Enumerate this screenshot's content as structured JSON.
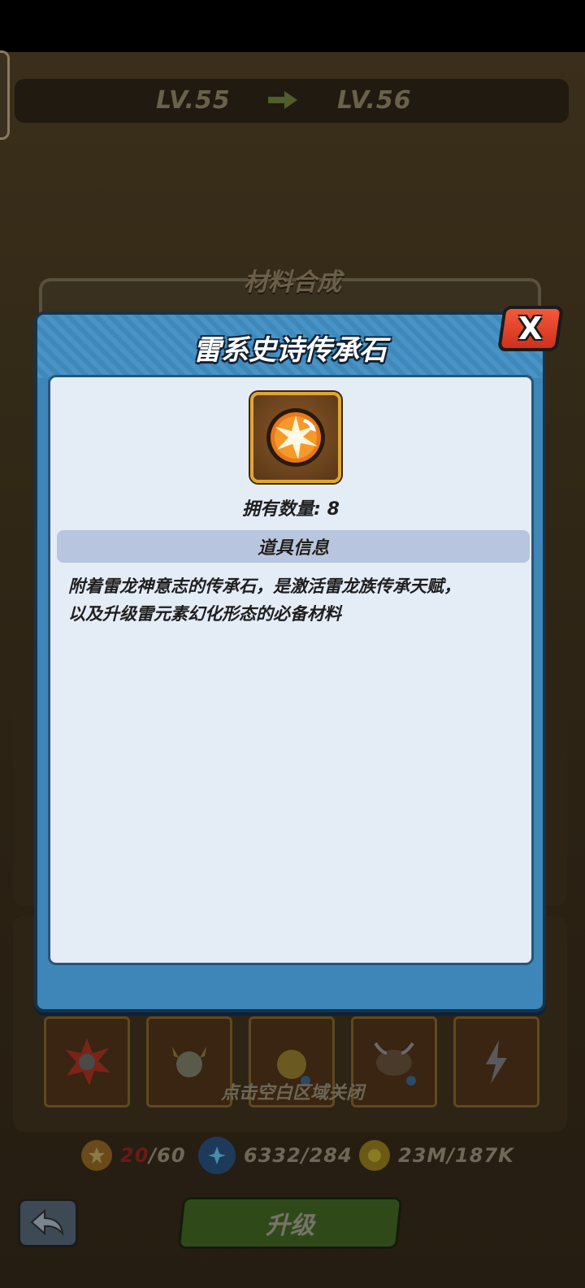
{
  "header": {
    "level_current": "LV.55",
    "level_next": "LV.56"
  },
  "panel": {
    "synthesis_title": "材料合成"
  },
  "modal": {
    "title": "雷系史诗传承石",
    "close_label": "X",
    "owned_count": "拥有数量: 8",
    "section_title": "道具信息",
    "description_lines": [
      "附着雷龙神意志的传承石，是激活雷龙族传承天赋，",
      "以及升级雷元素幻化形态的必备材料"
    ]
  },
  "hint": "点击空白区域关闭",
  "resources": {
    "stone": {
      "current": "20",
      "total": "/60"
    },
    "crystal": "6332/284",
    "gold": "23M/187K"
  },
  "buttons": {
    "upgrade_label": "升级"
  },
  "icons": {
    "item": "thunder-stone-icon",
    "back": "back-arrow-icon",
    "arrow": "right-arrow-icon"
  },
  "colors": {
    "modal_bg": "#3e86b8",
    "close_red": "#e0402a",
    "item_border": "#e0a630"
  }
}
